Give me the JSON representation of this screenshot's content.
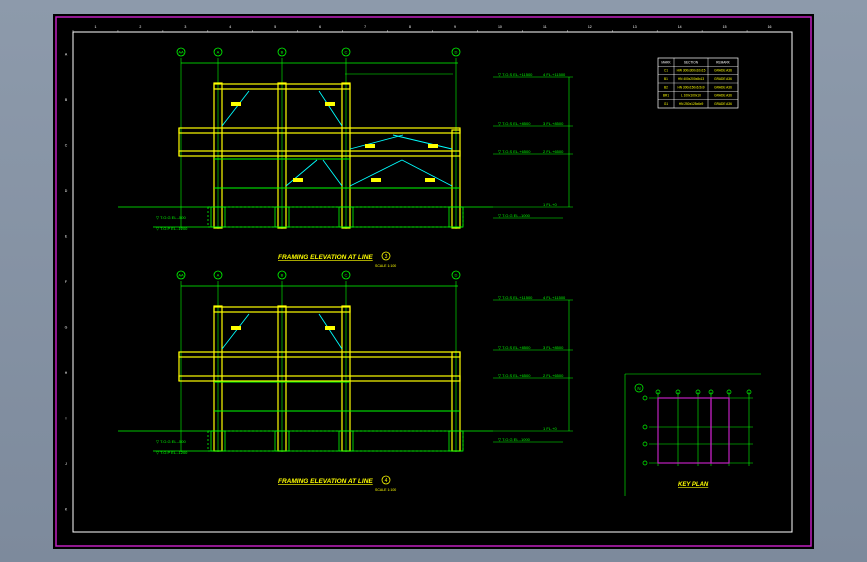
{
  "colors": {
    "background": "#000000",
    "frame": "#c020c0",
    "border": "#ffffff",
    "steel": "#ffff00",
    "member": "#00ff00",
    "brace": "#00ffff",
    "dim": "#00ff00",
    "label": "#ffff00"
  },
  "ruler_top": [
    "1",
    "2",
    "3",
    "4",
    "5",
    "6",
    "7",
    "8",
    "9",
    "10",
    "11",
    "12",
    "13",
    "14",
    "15",
    "16"
  ],
  "ruler_left": [
    "A",
    "B",
    "C",
    "D",
    "E",
    "F",
    "G",
    "H",
    "I",
    "J",
    "K"
  ],
  "elevation_1": {
    "title": "FRAMING ELEVATION AT LINE",
    "line_mark": "3",
    "scale": "SCALE 1:100",
    "grid_bubbles": [
      "AA",
      "A",
      "B",
      "C",
      "D"
    ]
  },
  "elevation_2": {
    "title": "FRAMING ELEVATION AT LINE",
    "line_mark": "4",
    "scale": "SCALE 1:100",
    "grid_bubbles": [
      "AA",
      "A",
      "B",
      "C",
      "D"
    ]
  },
  "key_plan": {
    "title": "KEY PLAN",
    "north": "N"
  },
  "schedule": {
    "headers": [
      "MARK",
      "SECTION",
      "REMARK"
    ],
    "rows": [
      [
        "C1",
        "HW 300x300x10x15",
        "GRADE A36"
      ],
      [
        "B1",
        "HN 400x200x8x13",
        "GRADE A36"
      ],
      [
        "B2",
        "HN 300x150x6.5x9",
        "GRADE A36"
      ],
      [
        "BR1",
        "L 100x100x10",
        "GRADE A36"
      ],
      [
        "G1",
        "HN 250x125x6x9",
        "GRADE A36"
      ]
    ]
  }
}
